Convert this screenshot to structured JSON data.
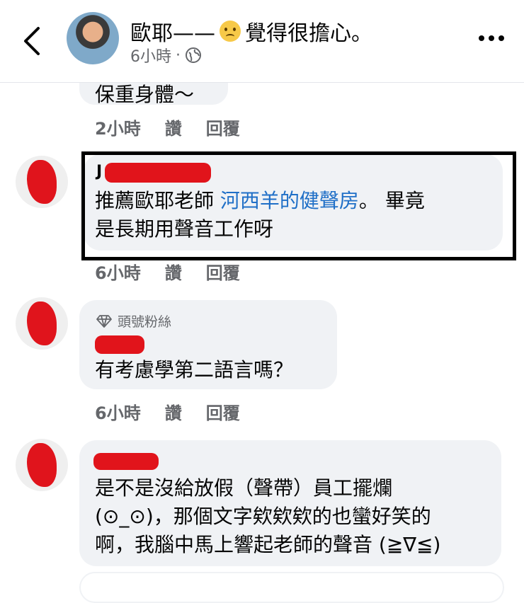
{
  "header": {
    "title_prefix": "歐耶——",
    "emoji": "worried-face-emoji",
    "title_suffix": "覺得很擔心。",
    "time": "6小時",
    "dot": "·",
    "back_icon": "chevron-left-icon",
    "globe_icon": "globe-icon",
    "more_icon": "more-dots-icon"
  },
  "partial_comment": {
    "text": "保重身體～",
    "time": "2小時",
    "like": "讚",
    "reply": "回覆"
  },
  "comments": [
    {
      "name_visible": "J",
      "text_part1": "推薦歐耶老師 ",
      "link_text": "河西羊的健聲房",
      "text_part2": "。 畢竟",
      "text_line2": "是長期用聲音工作呀",
      "time": "6小時",
      "like": "讚",
      "reply": "回覆"
    },
    {
      "badge_icon": "diamond-icon",
      "badge": "頭號粉絲",
      "text": "有考慮學第二語言嗎？",
      "time": "6小時",
      "like": "讚",
      "reply": "回覆"
    },
    {
      "line1": "是不是沒給放假（聲帶）員工擺爛",
      "line2": "(⊙_⊙)，那個文字欸欸欸的也蠻好笑的",
      "line3": "啊，我腦中馬上響起老師的聲音 (≧∇≦)"
    }
  ]
}
